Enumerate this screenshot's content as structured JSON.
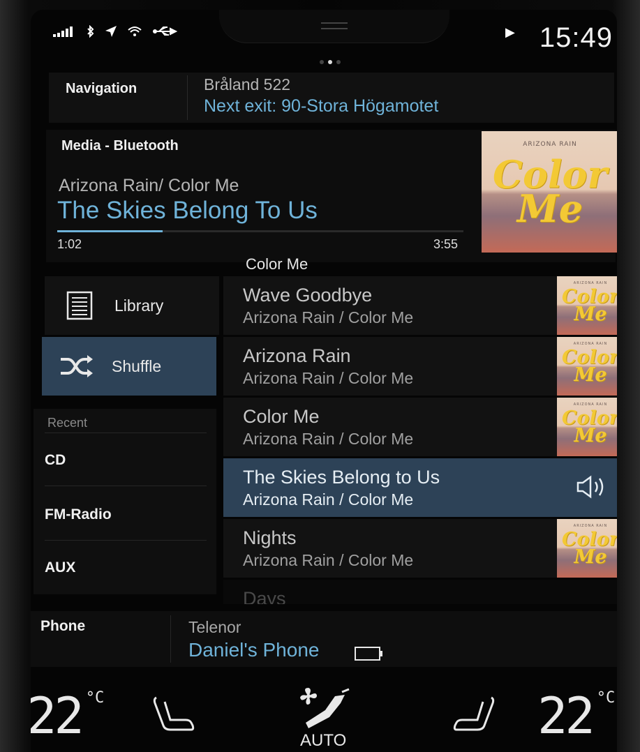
{
  "status_bar": {
    "icons": [
      "signal-icon",
      "bluetooth-icon",
      "location-icon",
      "wifi-icon",
      "usb-icon"
    ],
    "playing_icon": "play-icon",
    "time": "15:49",
    "page_dots": 3,
    "active_page": 2
  },
  "navigation": {
    "label": "Navigation",
    "street": "Bråland 522",
    "next_exit": "Next exit: 90-Stora Högamotet"
  },
  "media": {
    "label": "Media - Bluetooth",
    "artist_album": "Arizona Rain/ Color Me",
    "song": "The Skies Belong To Us",
    "elapsed": "1:02",
    "duration": "3:55",
    "progress_fraction": 0.26,
    "cover_band": "ARIZONA RAIN",
    "cover_title_line1": "Color",
    "cover_title_line2": "Me"
  },
  "list": {
    "title": "Color Me",
    "tracks": [
      {
        "title": "Wave Goodbye",
        "sub": "Arizona Rain / Color Me",
        "active": false
      },
      {
        "title": "Arizona Rain",
        "sub": "Arizona Rain / Color Me",
        "active": false
      },
      {
        "title": "Color Me",
        "sub": "Arizona Rain / Color Me",
        "active": false
      },
      {
        "title": "The Skies Belong to Us",
        "sub": "Arizona Rain / Color Me",
        "active": true
      },
      {
        "title": "Nights",
        "sub": "Arizona Rain / Color Me",
        "active": false
      },
      {
        "title": "Days",
        "sub": "",
        "active": false
      }
    ]
  },
  "menu": {
    "library": "Library",
    "shuffle": "Shuffle"
  },
  "recent": {
    "header": "Recent",
    "items": [
      "CD",
      "FM-Radio",
      "AUX"
    ]
  },
  "phone": {
    "label": "Phone",
    "operator": "Telenor",
    "device": "Daniel's Phone"
  },
  "climate": {
    "left_temp": "22",
    "right_temp": "22",
    "unit": "°C",
    "mode": "AUTO"
  },
  "colors": {
    "accent": "#6fb3d9",
    "active_row": "#2d4257",
    "cover_yellow": "#f3c935"
  }
}
